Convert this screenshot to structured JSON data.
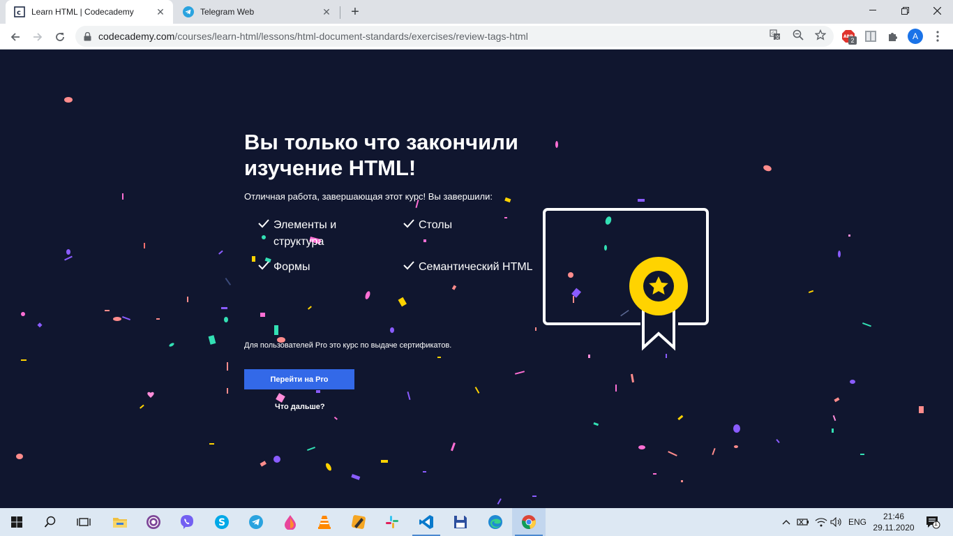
{
  "browser": {
    "tabs": [
      {
        "title": "Learn HTML | Codecademy",
        "active": true,
        "favicon": "codecademy-icon"
      },
      {
        "title": "Telegram Web",
        "active": false,
        "favicon": "telegram-icon"
      }
    ],
    "url_host": "codecademy.com",
    "url_path": "/courses/learn-html/lessons/html-document-standards/exercises/review-tags-html",
    "profile_initial": "A",
    "adblock_badge": "2"
  },
  "page": {
    "headline": "Вы только что закончили изучение HTML!",
    "intro": "Отличная работа, завершающая этот курс! Вы завершили:",
    "completed": [
      "Элементы и структура",
      "Столы",
      "Формы",
      "Семантический HTML"
    ],
    "pro_note": "Для пользователей Pro это курс по выдаче сертификатов.",
    "pro_button": "Перейти на Pro",
    "next_link": "Что дальше?"
  },
  "taskbar": {
    "language": "ENG",
    "time": "21:46",
    "date": "29.11.2020",
    "notifications": "1"
  },
  "colors": {
    "page_background": "#10162f",
    "button": "#3369e8",
    "medal": "#ffd300"
  }
}
